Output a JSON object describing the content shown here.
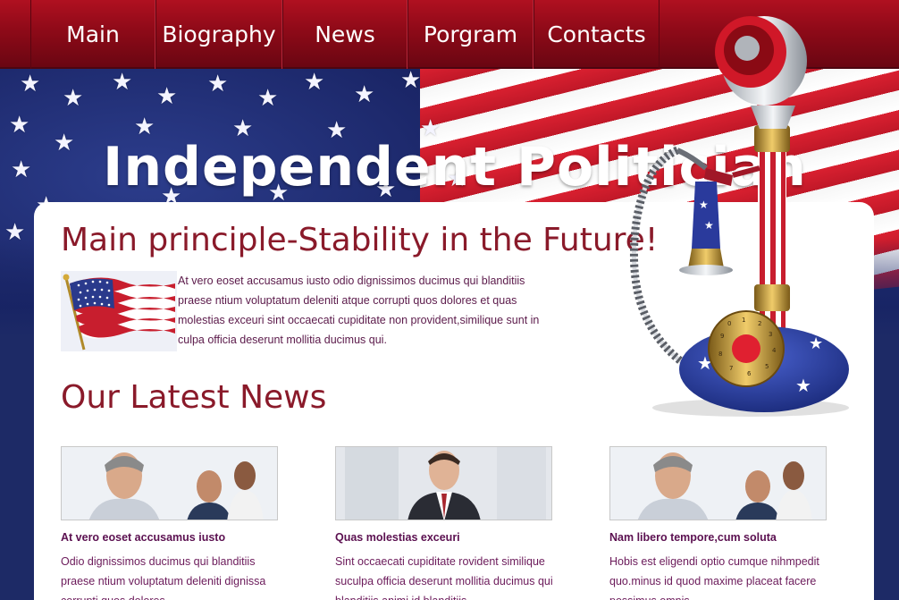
{
  "nav": {
    "items": [
      {
        "label": "Main"
      },
      {
        "label": "Biography"
      },
      {
        "label": "News"
      },
      {
        "label": "Porgram"
      },
      {
        "label": "Contacts"
      }
    ]
  },
  "hero": {
    "title": "Independent Politician"
  },
  "main": {
    "principle_title": "Main principle-Stability in the Future!",
    "intro_text": "At vero eoset accusamus iusto odio dignissimos ducimus qui blanditiis praese ntium voluptatum deleniti atque corrupti quos dolores et quas molestias exceuri sint occaecati cupiditate non provident,similique sunt in culpa officia deserunt mollitia ducimus qui.",
    "news_title": "Our Latest News",
    "news": [
      {
        "headline": "At vero eoset accusamus iusto",
        "body": "Odio dignissimos ducimus qui blanditiis praese ntium voluptatum deleniti dignissa corrupti quos dolores"
      },
      {
        "headline": "Quas molestias exceuri",
        "body": "Sint occaecati cupiditate rovident similique suculpa officia deserunt mollitia ducimus qui blanditiis animi id blanditiis"
      },
      {
        "headline": "Nam libero tempore,cum soluta",
        "body": "Hobis est eligendi optio cumque nihmpedit quo.minus id quod maxime placeat facere possimus omnis"
      }
    ]
  },
  "colors": {
    "nav_red": "#8e0a18",
    "title_red": "#8a1a2a",
    "text_purple": "#5b1a4a",
    "flag_blue": "#1b2a6e"
  }
}
